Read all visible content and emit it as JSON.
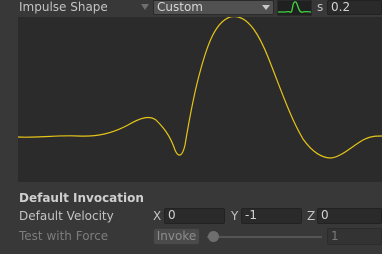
{
  "impulse_shape": {
    "label": "Impulse Shape",
    "selected": "Custom",
    "duration_unit": "s",
    "duration": "0.2",
    "curve_color": "#e6c419",
    "mini_curve_color": "#3fd43f"
  },
  "default_invocation": {
    "heading": "Default Invocation",
    "velocity_label": "Default Velocity",
    "x_label": "X",
    "x_value": "0",
    "y_label": "Y",
    "y_value": "-1",
    "z_label": "Z",
    "z_value": "0"
  },
  "test_force": {
    "label": "Test with Force",
    "button": "Invoke",
    "value": "1",
    "slider_fraction": 0
  }
}
